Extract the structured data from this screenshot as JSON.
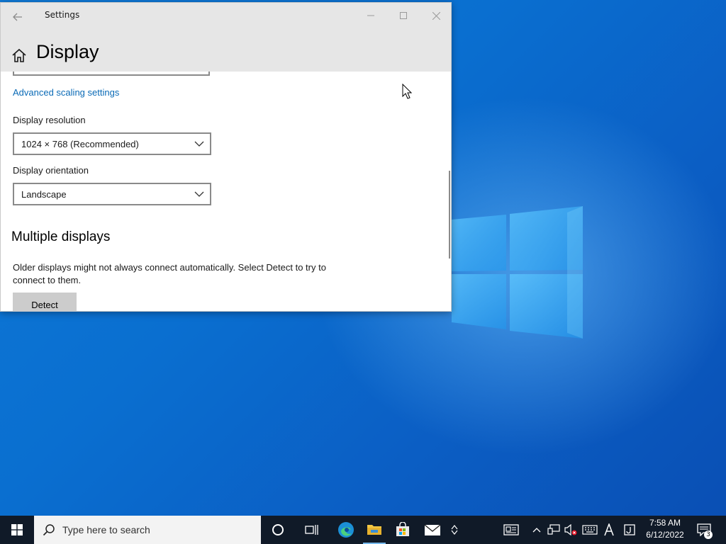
{
  "window": {
    "app_title": "Settings",
    "page_title": "Display"
  },
  "content": {
    "advanced_link": "Advanced scaling settings",
    "resolution_label": "Display resolution",
    "resolution_value": "1024 × 768 (Recommended)",
    "orientation_label": "Display orientation",
    "orientation_value": "Landscape",
    "multiple_title": "Multiple displays",
    "multiple_desc": "Older displays might not always connect automatically. Select Detect to try to connect to them.",
    "detect_label": "Detect"
  },
  "taskbar": {
    "search_placeholder": "Type here to search",
    "time": "7:58 AM",
    "date": "6/12/2022",
    "notification_count": "3"
  }
}
